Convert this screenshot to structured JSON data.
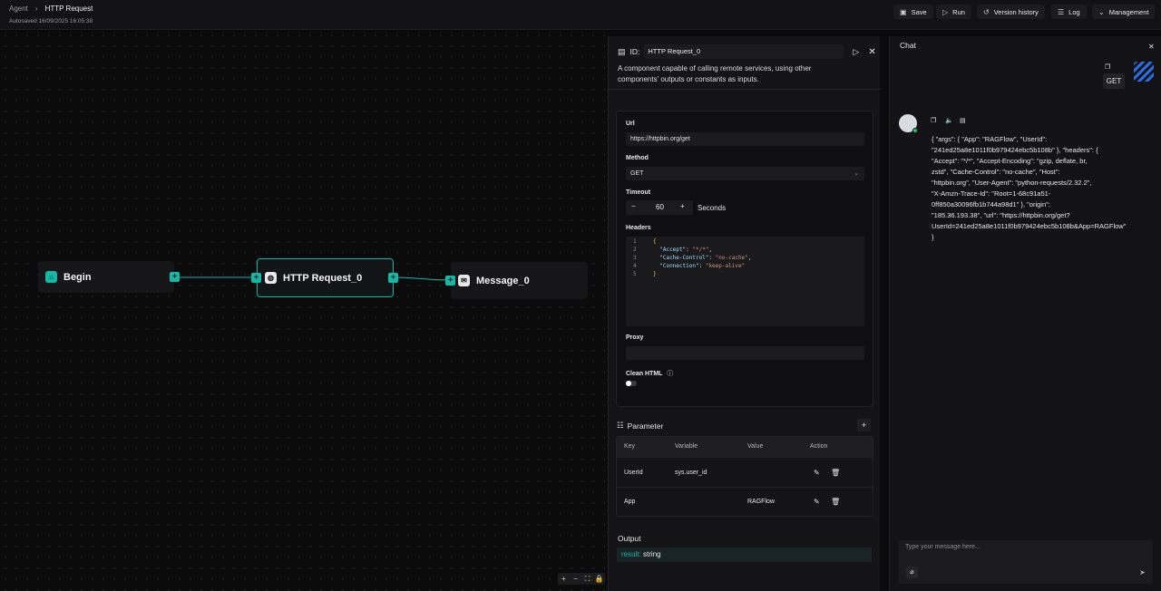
{
  "breadcrumb": {
    "root": "Agent",
    "current": "HTTP Request"
  },
  "autosave": "Autosaved 16/09/2025 16:05:38",
  "toolbar": {
    "save": "Save",
    "run": "Run",
    "history": "Version history",
    "log": "Log",
    "management": "Management"
  },
  "nodes": {
    "begin": "Begin",
    "http": "HTTP Request_0",
    "message": "Message_0"
  },
  "panel": {
    "id_label": "ID:",
    "id_value": "HTTP Request_0",
    "description": "A component capable of calling remote services, using other components' outputs or constants as inputs.",
    "url_label": "Url",
    "url_value": "https://httpbin.org/get",
    "method_label": "Method",
    "method_value": "GET",
    "timeout_label": "Timeout",
    "timeout_value": "60",
    "timeout_unit": "Seconds",
    "headers_label": "Headers",
    "proxy_label": "Proxy",
    "clean_html_label": "Clean HTML",
    "parameter_label": "Parameter",
    "table_headers": [
      "Key",
      "Variable",
      "Value",
      "Action"
    ],
    "rows": [
      {
        "key": "UserId",
        "variable": "sys.user_id",
        "value": ""
      },
      {
        "key": "App",
        "variable": "",
        "value": "RAGFlow"
      }
    ],
    "output_label": "Output",
    "output_key": "result:",
    "output_type": "string"
  },
  "chat": {
    "title": "Chat",
    "user_msg": "GET",
    "reply": "{ \"args\": { \"App\": \"RAGFlow\", \"UserId\": \"241ed25a8e1011f0b979424ebc5b108b\" }, \"headers\": { \"Accept\": \"*/*\", \"Accept-Encoding\": \"gzip, deflate, br, zstd\", \"Cache-Control\": \"no-cache\", \"Host\": \"httpbin.org\", \"User-Agent\": \"python-requests/2.32.2\", \"X-Amzn-Trace-Id\": \"Root=1-68c91a51-0ff850a30096fb1b744a98d1\" }, \"origin\": \"185.36.193.38\", \"url\": \"https://httpbin.org/get?UserId=241ed25a8e1011f0b979424ebc5b108b&App=RAGFlow\" }",
    "input_placeholder": "Type your message here..."
  },
  "colors": {
    "accent": "#14b8a6",
    "bg": "#0b0b0c"
  }
}
